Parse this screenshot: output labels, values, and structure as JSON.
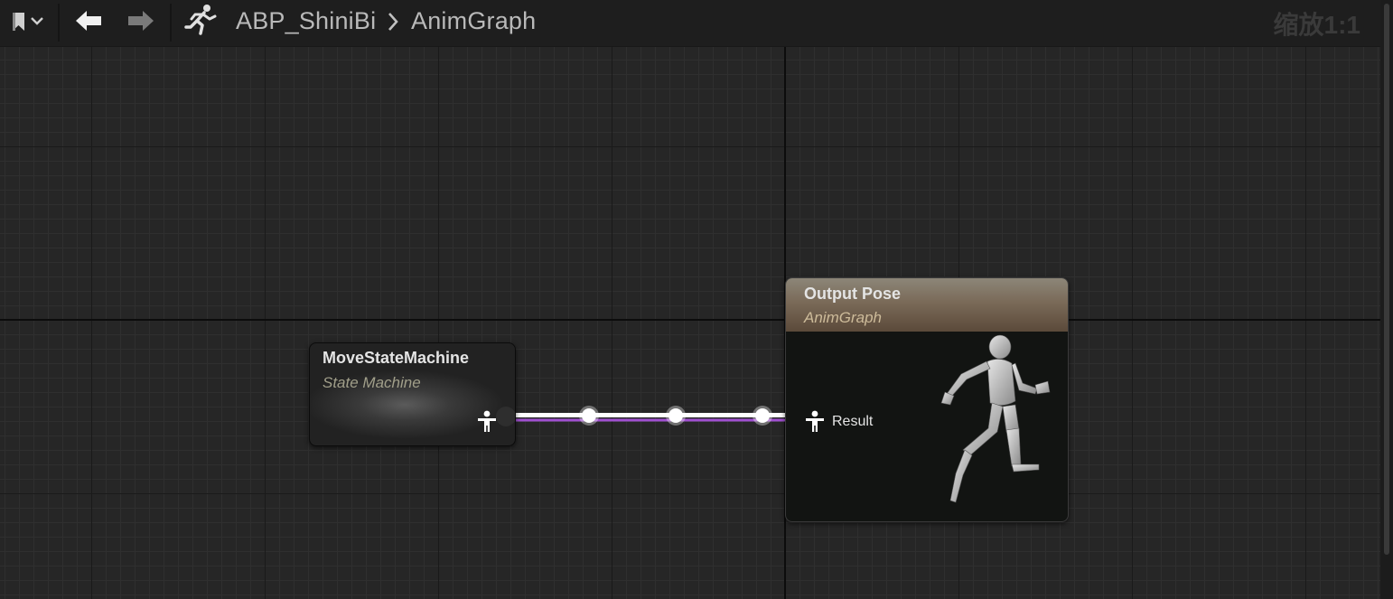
{
  "toolbar": {
    "bookmark_icon": "bookmark-icon",
    "back_icon": "arrow-left-icon",
    "forward_icon": "arrow-right-icon",
    "asset_icon": "running-figure-icon",
    "breadcrumb": {
      "asset": "ABP_ShiniBi",
      "separator": "chevron-right-icon",
      "graph": "AnimGraph"
    },
    "zoom_label": "缩放1:1"
  },
  "nodes": {
    "state_machine": {
      "title": "MoveStateMachine",
      "subtitle": "State Machine",
      "output_pin_icon": "pose-pin-icon"
    },
    "output_pose": {
      "title": "Output Pose",
      "subtitle": "AnimGraph",
      "input_pin_label": "Result",
      "input_pin_icon": "pose-pin-icon",
      "preview_icon": "running-mannequin-icon"
    }
  },
  "colors": {
    "canvas": "#262626",
    "wire_pose": "#ffffff",
    "wire_exec": "#a050d0",
    "output_header": "#7a6a58"
  }
}
